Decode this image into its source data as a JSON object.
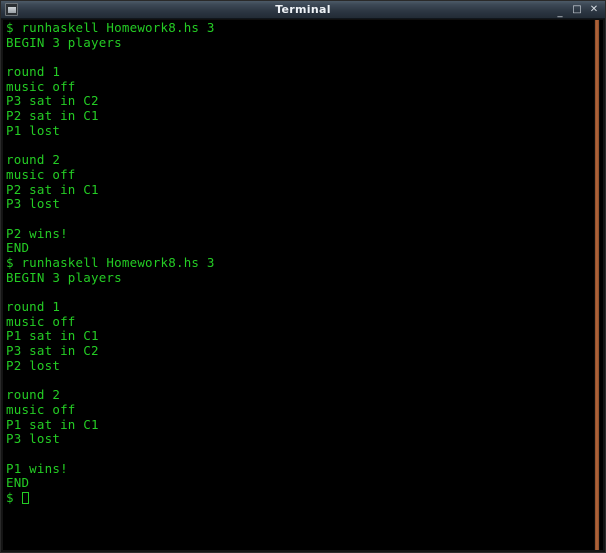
{
  "window": {
    "title": "Terminal",
    "icon": "terminal-icon",
    "controls": {
      "minimize": "_",
      "maximize": "□",
      "close": "✕"
    }
  },
  "theme": {
    "terminal_background": "#000000",
    "terminal_foreground": "#24cc24",
    "titlebar_background": "#3c4855",
    "titlebar_foreground": "#eef2f6",
    "scrollbar_thumb": "#b4673c"
  },
  "terminal": {
    "prompt_symbol": "$",
    "cursor": "block-outline",
    "lines": [
      "$ runhaskell Homework8.hs 3",
      "BEGIN 3 players",
      "",
      "round 1",
      "music off",
      "P3 sat in C2",
      "P2 sat in C1",
      "P1 lost",
      "",
      "round 2",
      "music off",
      "P2 sat in C1",
      "P3 lost",
      "",
      "P2 wins!",
      "END",
      "$ runhaskell Homework8.hs 3",
      "BEGIN 3 players",
      "",
      "round 1",
      "music off",
      "P1 sat in C1",
      "P3 sat in C2",
      "P2 lost",
      "",
      "round 2",
      "music off",
      "P1 sat in C1",
      "P3 lost",
      "",
      "P1 wins!",
      "END"
    ],
    "last_prompt": "$ "
  }
}
